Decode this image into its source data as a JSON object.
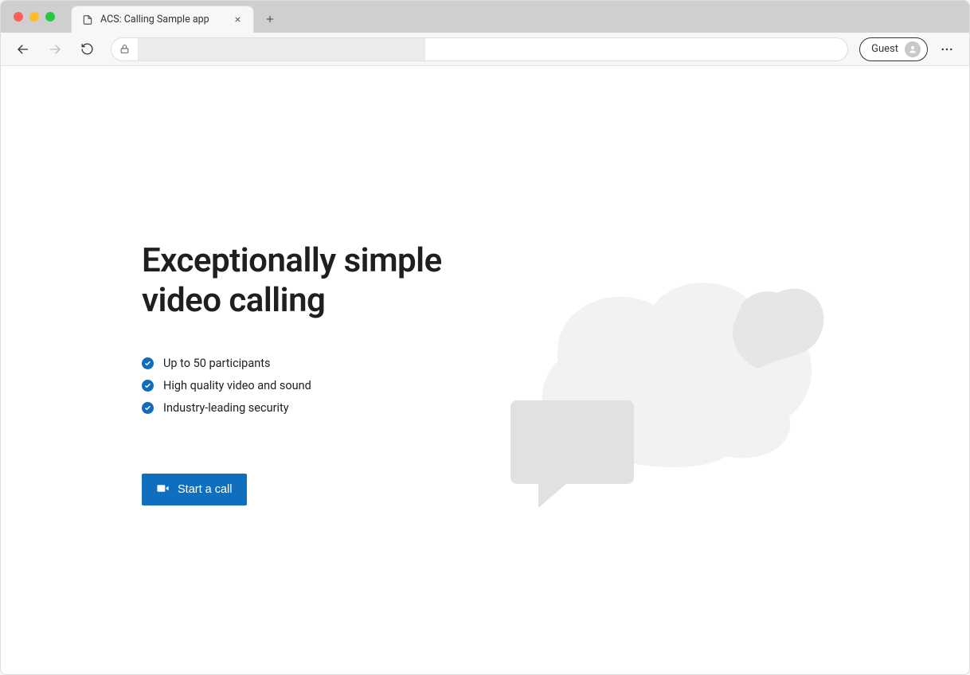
{
  "browser": {
    "tab_title": "ACS: Calling Sample app",
    "guest_label": "Guest",
    "address_value": ""
  },
  "hero": {
    "heading_line1": "Exceptionally simple",
    "heading_line2": "video calling"
  },
  "features": {
    "items": [
      {
        "label": "Up to 50 participants"
      },
      {
        "label": "High quality video and sound"
      },
      {
        "label": "Industry-leading security"
      }
    ]
  },
  "cta": {
    "start_call_label": "Start a call"
  }
}
